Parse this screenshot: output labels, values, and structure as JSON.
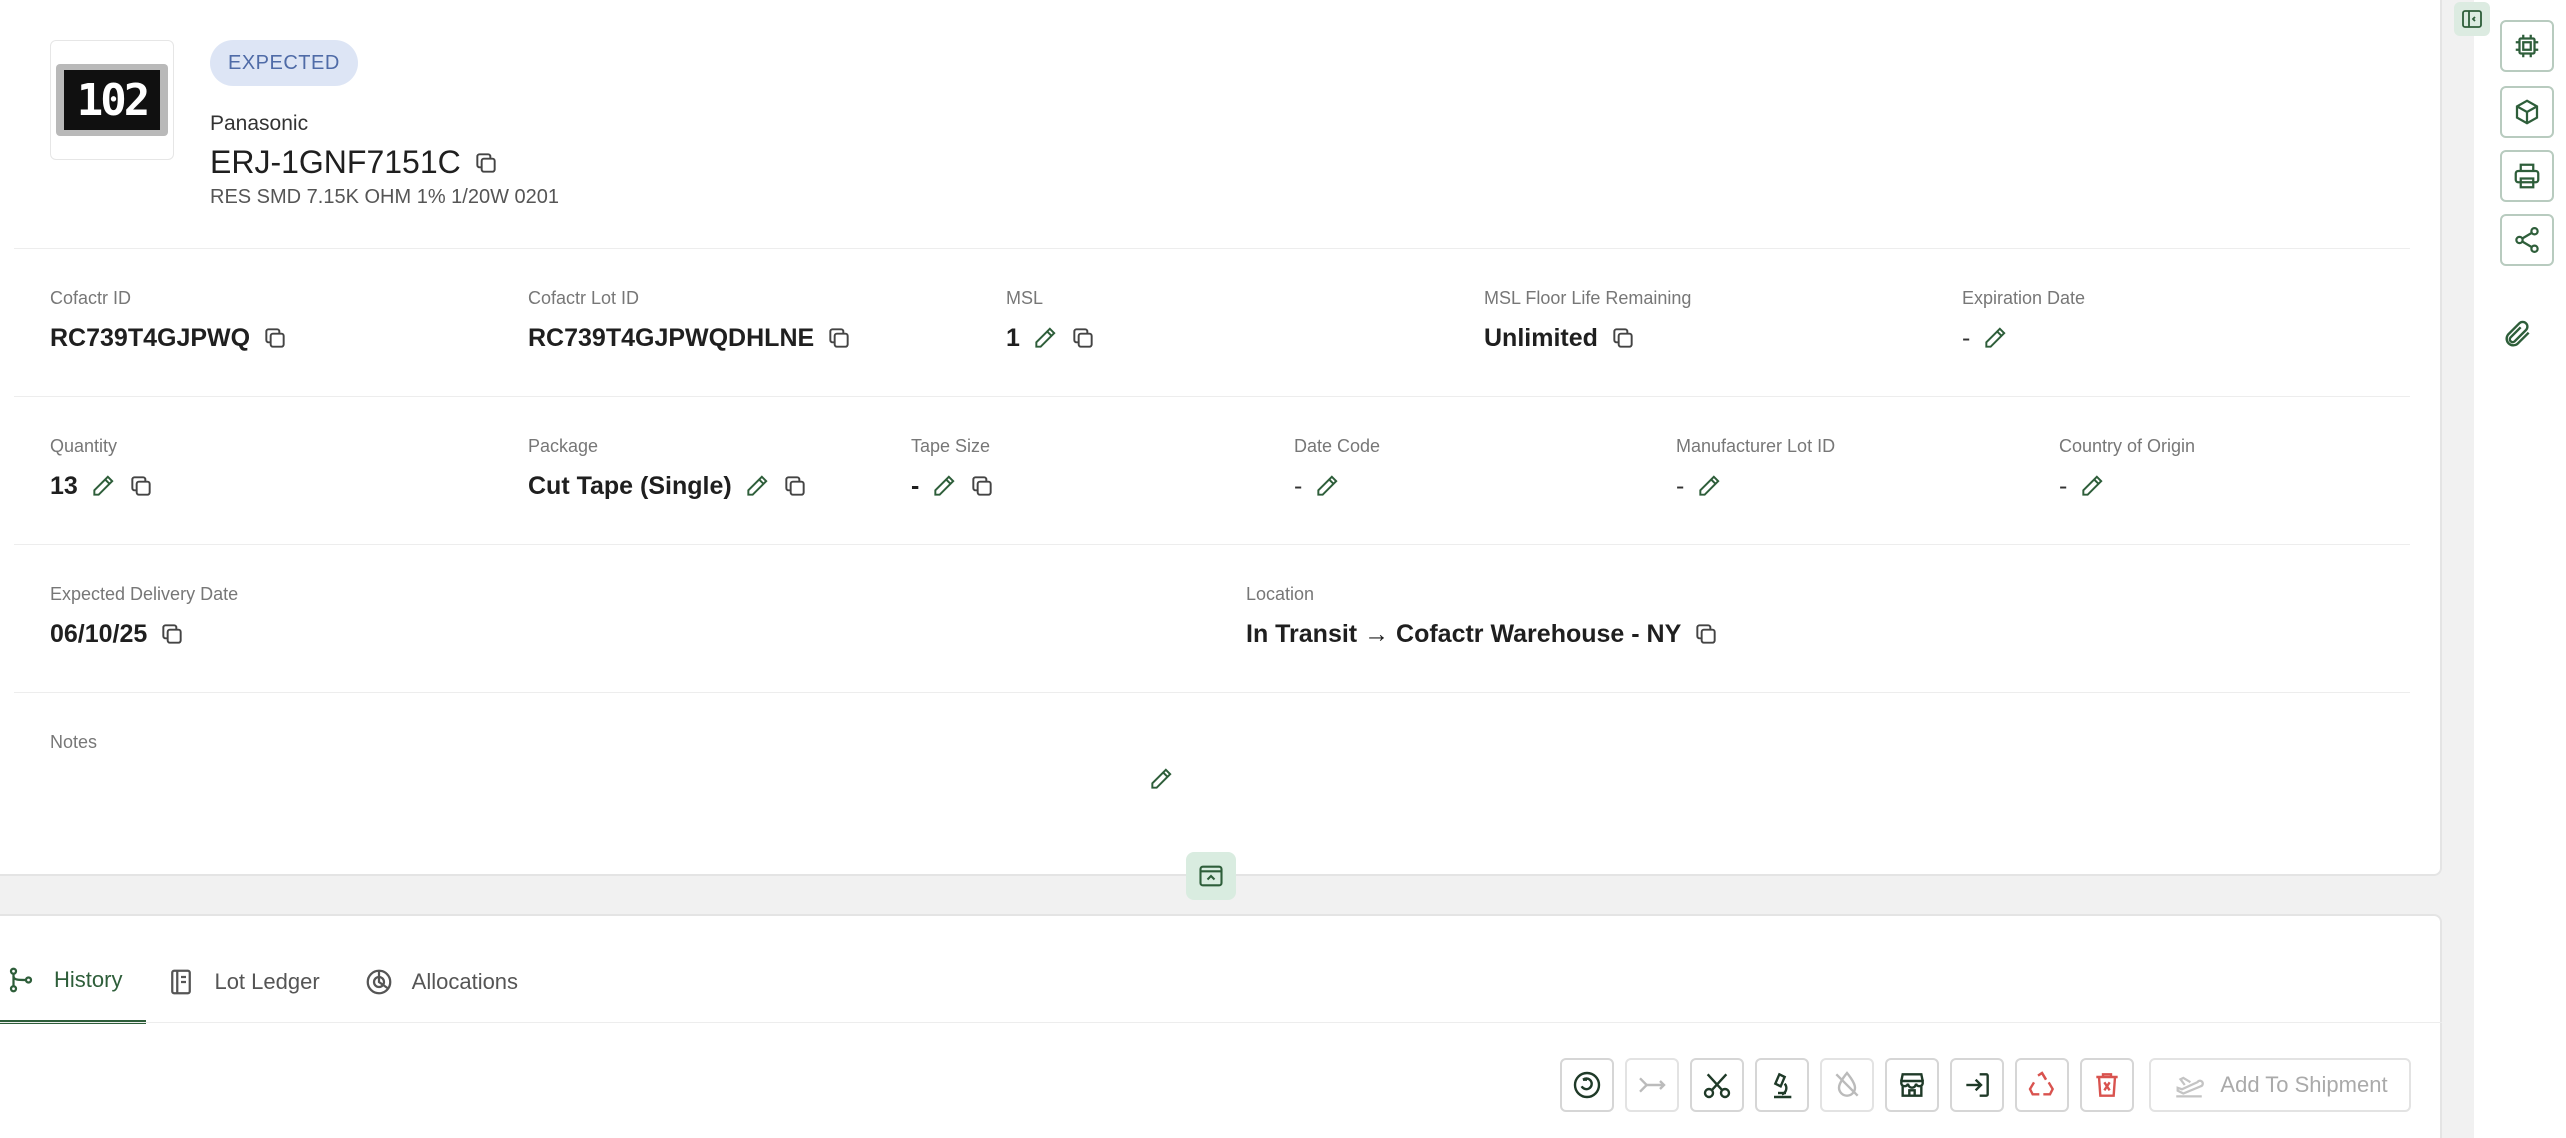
{
  "header": {
    "status_badge": "EXPECTED",
    "thumbnail_marking": "102",
    "manufacturer": "Panasonic",
    "part_number": "ERJ-1GNF7151C",
    "description": "RES SMD 7.15K OHM 1% 1/20W 0201"
  },
  "fields": {
    "cofactr_id": {
      "label": "Cofactr ID",
      "value": "RC739T4GJPWQ"
    },
    "cofactr_lot_id": {
      "label": "Cofactr Lot ID",
      "value": "RC739T4GJPWQDHLNE"
    },
    "msl": {
      "label": "MSL",
      "value": "1"
    },
    "msl_floor_life": {
      "label": "MSL Floor Life Remaining",
      "value": "Unlimited"
    },
    "expiration_date": {
      "label": "Expiration Date",
      "value": "-"
    },
    "quantity": {
      "label": "Quantity",
      "value": "13"
    },
    "package": {
      "label": "Package",
      "value": "Cut Tape (Single)"
    },
    "tape_size": {
      "label": "Tape Size",
      "value": "-"
    },
    "date_code": {
      "label": "Date Code",
      "value": "-"
    },
    "manufacturer_lot_id": {
      "label": "Manufacturer Lot ID",
      "value": "-"
    },
    "country_of_origin": {
      "label": "Country of Origin",
      "value": "-"
    },
    "expected_delivery_date": {
      "label": "Expected Delivery Date",
      "value": "06/10/25"
    },
    "location": {
      "label": "Location",
      "value": "In Transit → Cofactr Warehouse - NY"
    },
    "notes": {
      "label": "Notes",
      "value": ""
    }
  },
  "tabs": [
    {
      "label": "History",
      "icon": "git-branch-icon",
      "active": true
    },
    {
      "label": "Lot Ledger",
      "icon": "ledger-book-icon",
      "active": false
    },
    {
      "label": "Allocations",
      "icon": "pie-chart-icon",
      "active": false
    }
  ],
  "actions": {
    "add_to_shipment_label": "Add To Shipment"
  },
  "colors": {
    "accent": "#2e5e3a",
    "badge_bg": "#dde5f5",
    "badge_text": "#4f6ba7",
    "danger": "#d9534f"
  }
}
